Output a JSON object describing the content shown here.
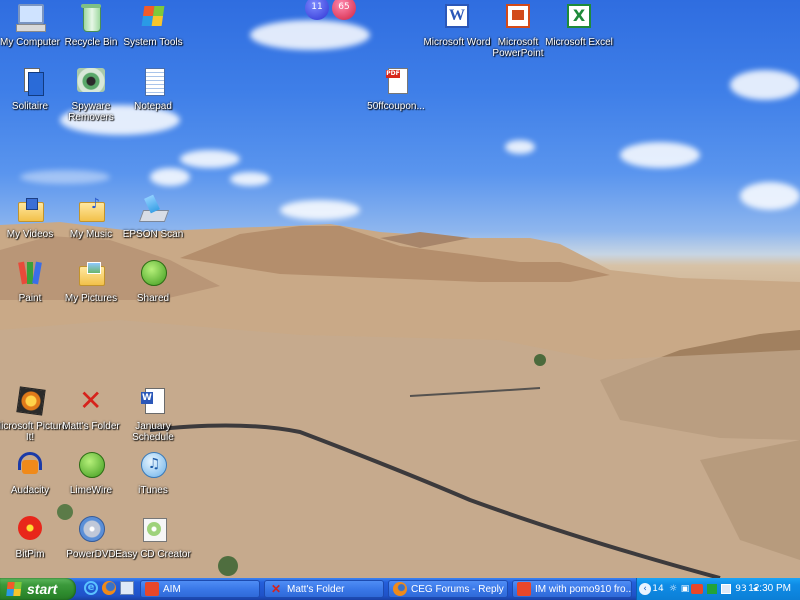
{
  "desktop": {
    "icons": [
      {
        "label": "My Computer",
        "icon": "my-computer-icon"
      },
      {
        "label": "Recycle Bin",
        "icon": "recycle-bin-icon"
      },
      {
        "label": "System Tools",
        "icon": "system-tools-icon"
      },
      {
        "label": "Solitaire",
        "icon": "solitaire-icon"
      },
      {
        "label": "Spyware Removers",
        "icon": "spyware-removers-icon"
      },
      {
        "label": "Notepad",
        "icon": "notepad-icon"
      },
      {
        "label": "My Videos",
        "icon": "my-videos-folder-icon"
      },
      {
        "label": "My Music",
        "icon": "my-music-folder-icon"
      },
      {
        "label": "EPSON Scan",
        "icon": "epson-scan-icon"
      },
      {
        "label": "Paint",
        "icon": "paint-icon"
      },
      {
        "label": "My Pictures",
        "icon": "my-pictures-folder-icon"
      },
      {
        "label": "Shared",
        "icon": "limewire-shared-icon"
      },
      {
        "label": "Microsoft Picture It!",
        "icon": "picture-it-icon"
      },
      {
        "label": "Matt's Folder",
        "icon": "matts-folder-icon"
      },
      {
        "label": "January Schedule",
        "icon": "word-document-icon"
      },
      {
        "label": "Audacity",
        "icon": "audacity-icon"
      },
      {
        "label": "LimeWire",
        "icon": "limewire-icon"
      },
      {
        "label": "iTunes",
        "icon": "itunes-icon"
      },
      {
        "label": "BitPim",
        "icon": "bitpim-icon"
      },
      {
        "label": "PowerDVD",
        "icon": "powerdvd-icon"
      },
      {
        "label": "Easy CD Creator",
        "icon": "easy-cd-creator-icon"
      },
      {
        "label": "50ffcoupon...",
        "icon": "pdf-file-icon"
      },
      {
        "label": "Microsoft Word",
        "icon": "word-icon"
      },
      {
        "label": "Microsoft PowerPoint",
        "icon": "powerpoint-icon"
      },
      {
        "label": "Microsoft Excel",
        "icon": "excel-icon"
      }
    ],
    "top_widget": {
      "left_value": "11",
      "right_value": "65"
    }
  },
  "taskbar": {
    "start_label": "start",
    "quick_launch": [
      "internet-explorer-icon",
      "firefox-icon",
      "show-desktop-icon"
    ],
    "tasks": [
      {
        "label": "AIM",
        "icon": "aim-icon",
        "color": "#e8472a"
      },
      {
        "label": "Matt's Folder",
        "icon": "folder-x-icon",
        "color": "#cc2222"
      },
      {
        "label": "CEG Forums - Reply ...",
        "icon": "firefox-icon",
        "color": "#e8772a"
      },
      {
        "label": "IM with pomo910 fro...",
        "icon": "aim-im-icon",
        "color": "#e8472a"
      }
    ],
    "tray": {
      "temperature": "14",
      "badge": "93",
      "clock": "12:30 PM"
    }
  }
}
